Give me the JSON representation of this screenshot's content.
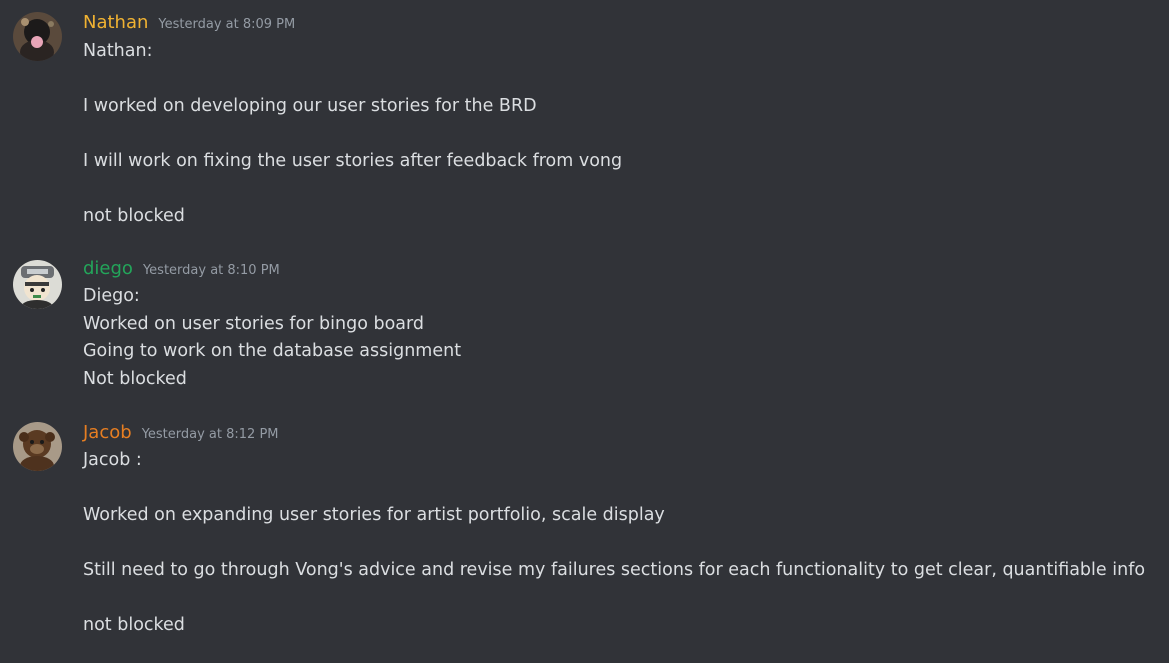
{
  "messages": [
    {
      "username": "Nathan",
      "username_color": "#f0b232",
      "timestamp": "Yesterday at 8:09 PM",
      "avatar": "nathan-avatar",
      "lines": [
        "Nathan:",
        "",
        "I worked on developing our user stories for the BRD",
        "",
        "I will work on fixing the user stories after feedback from vong",
        "",
        "not blocked"
      ]
    },
    {
      "username": "diego",
      "username_color": "#23a55a",
      "timestamp": "Yesterday at 8:10 PM",
      "avatar": "diego-avatar",
      "lines": [
        "Diego:",
        "Worked on user stories for bingo board",
        "Going to work on the database assignment",
        "Not blocked"
      ]
    },
    {
      "username": "Jacob",
      "username_color": "#e67e22",
      "timestamp": "Yesterday at 8:12 PM",
      "avatar": "jacob-avatar",
      "lines": [
        "Jacob :",
        "",
        "Worked on expanding user stories for artist portfolio, scale display",
        "",
        "Still need to go through Vong's advice and revise my failures sections for each functionality to get clear, quantifiable info",
        "",
        "not blocked"
      ]
    }
  ]
}
